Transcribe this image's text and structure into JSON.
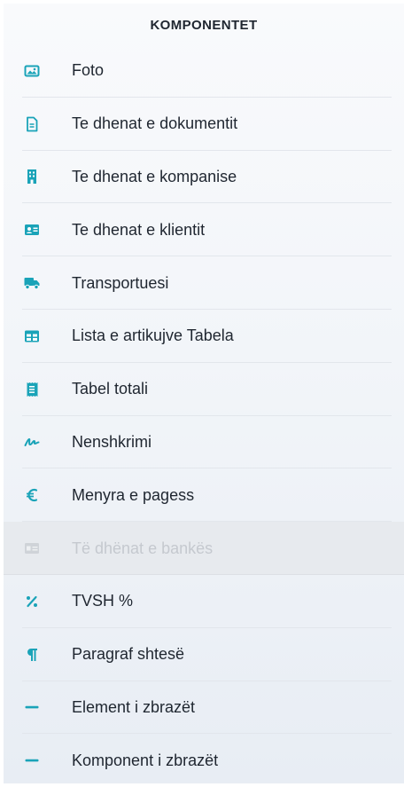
{
  "panel": {
    "title": "KOMPONENTET",
    "accent_color": "#1aa3b8",
    "disabled_color": "#c5c9cf",
    "items": [
      {
        "label": "Foto",
        "icon": "image-icon"
      },
      {
        "label": "Te dhenat e dokumentit",
        "icon": "document-icon"
      },
      {
        "label": "Te dhenat e kompanise",
        "icon": "building-icon"
      },
      {
        "label": "Te dhenat e klientit",
        "icon": "id-card-icon"
      },
      {
        "label": "Transportuesi",
        "icon": "truck-icon"
      },
      {
        "label": "Lista e artikujve Tabela",
        "icon": "table-icon"
      },
      {
        "label": "Tabel totali",
        "icon": "receipt-icon"
      },
      {
        "label": "Nenshkrimi",
        "icon": "signature-icon"
      },
      {
        "label": "Menyra e pagess",
        "icon": "euro-icon"
      },
      {
        "label": "Të dhënat e bankës",
        "icon": "bank-card-icon",
        "disabled": true
      },
      {
        "label": "TVSH %",
        "icon": "percent-icon"
      },
      {
        "label": "Paragraf shtesë",
        "icon": "paragraph-icon"
      },
      {
        "label": "Element i zbrazët",
        "icon": "minus-icon"
      },
      {
        "label": "Komponent i zbrazët",
        "icon": "minus-icon"
      }
    ]
  }
}
